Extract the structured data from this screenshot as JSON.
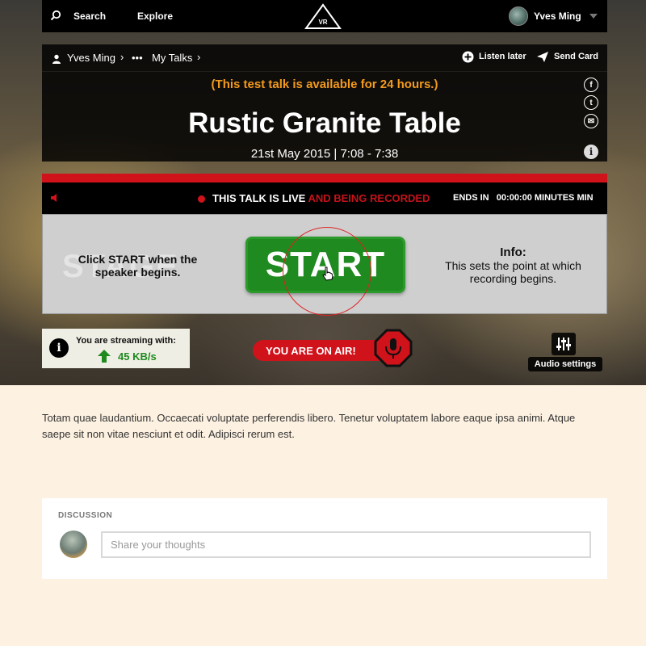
{
  "nav": {
    "search_label": "Search",
    "explore_label": "Explore",
    "logo_text": "VR",
    "user_name": "Yves Ming"
  },
  "breadcrumb": {
    "user": "Yves Ming",
    "ellipsis": "•••",
    "section": "My Talks"
  },
  "actions": {
    "listen_later": "Listen later",
    "send_card": "Send Card"
  },
  "talk": {
    "availability_note": "(This test talk is available for 24 hours.)",
    "title": "Rustic Granite Table",
    "datetime": "21st May 2015 | 7:08 - 7:38"
  },
  "live_status": {
    "live_text": "THIS TALK IS LIVE",
    "recorded_text": "AND BEING RECORDED",
    "ends_label": "ENDS IN",
    "timer": "00:00:00 MINUTES MIN"
  },
  "start_panel": {
    "stage_ghost": "STAGE",
    "instruction": "Click START when the speaker begins.",
    "start_label": "START",
    "info_title": "Info:",
    "info_body": "This sets the point at which recording begins."
  },
  "streaming": {
    "label": "You are streaming with:",
    "speed": "45 KB/s"
  },
  "on_air": {
    "label": "YOU ARE ON AIR!"
  },
  "audio_settings": {
    "label": "Audio settings"
  },
  "description": "Totam quae laudantium. Occaecati voluptate perferendis libero. Tenetur voluptatem labore eaque ipsa animi. Atque saepe sit non vitae nesciunt et odit. Adipisci rerum est.",
  "discussion": {
    "heading": "DISCUSSION",
    "placeholder": "Share your thoughts"
  },
  "colors": {
    "accent_red": "#d0121b",
    "start_green": "#1f8a1f",
    "availability_orange": "#f39a1c",
    "page_background": "#fdf1e1"
  },
  "icons": [
    "search-icon",
    "vr-logo-icon",
    "user-icon",
    "chevron-right-icon",
    "plus-circle-icon",
    "send-icon",
    "facebook-icon",
    "twitter-icon",
    "email-icon",
    "info-icon",
    "speaker-icon",
    "cursor-hand-icon",
    "arrow-up-icon",
    "microphone-icon",
    "sliders-icon",
    "caret-down-icon"
  ]
}
